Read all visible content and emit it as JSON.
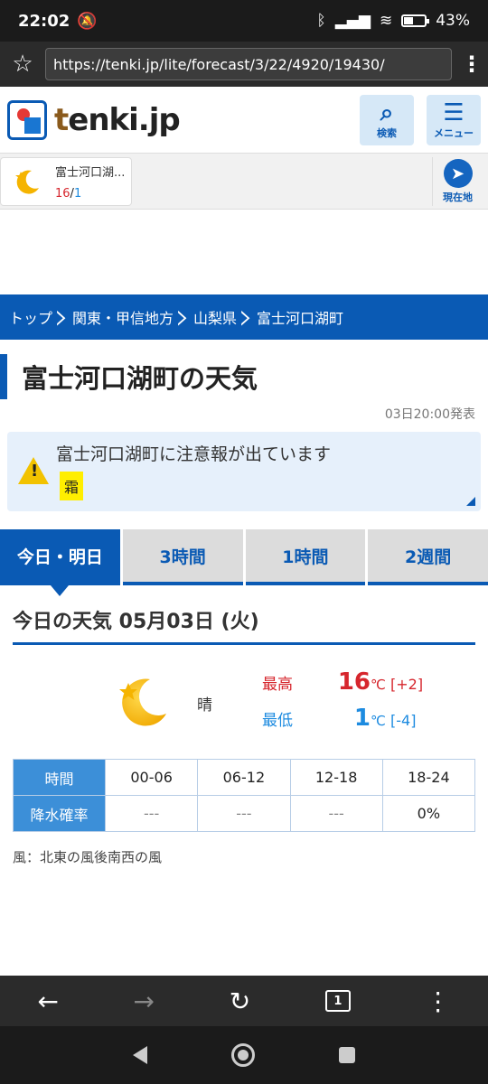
{
  "status_bar": {
    "time": "22:02",
    "battery": "43%",
    "battery_level": 0.43
  },
  "browser": {
    "url": "https://tenki.jp/lite/forecast/3/22/4920/19430/"
  },
  "header": {
    "logo_text_t": "t",
    "logo_text_rest": "enki.jp",
    "search_label": "検索",
    "menu_label": "メニュー"
  },
  "my_location": {
    "name": "富士河口湖...",
    "high": "16",
    "low": "1",
    "separator": "/",
    "current_location_label": "現在地"
  },
  "breadcrumb": [
    {
      "label": "トップ"
    },
    {
      "label": "関東・甲信地方"
    },
    {
      "label": "山梨県"
    },
    {
      "label": "富士河口湖町"
    }
  ],
  "page": {
    "title": "富士河口湖町の天気",
    "issued": "03日20:00発表"
  },
  "warning": {
    "message": "富士河口湖町に注意報が出ています",
    "tag": "霜"
  },
  "tabs": [
    {
      "label": "今日・明日",
      "active": true
    },
    {
      "label": "3時間",
      "active": false
    },
    {
      "label": "1時間",
      "active": false
    },
    {
      "label": "2週間",
      "active": false
    }
  ],
  "today": {
    "heading": "今日の天気 05月03日 (火)",
    "weather": "晴",
    "high_label": "最高",
    "high_value": "16",
    "high_diff": "[+2]",
    "low_label": "最低",
    "low_value": "1",
    "low_diff": "[-4]",
    "unit": "℃"
  },
  "precip_table": {
    "time_header": "時間",
    "prob_header": "降水確率",
    "periods": [
      "00-06",
      "06-12",
      "12-18",
      "18-24"
    ],
    "values": [
      "---",
      "---",
      "---",
      "0%"
    ]
  },
  "wind": "風：北東の風後南西の風",
  "bottom_bar": {
    "tab_count": "1"
  },
  "colors": {
    "brand_blue": "#0a5ab4",
    "high_red": "#d6262d",
    "low_blue": "#1d8be0",
    "warning_yellow": "#ffee00"
  }
}
